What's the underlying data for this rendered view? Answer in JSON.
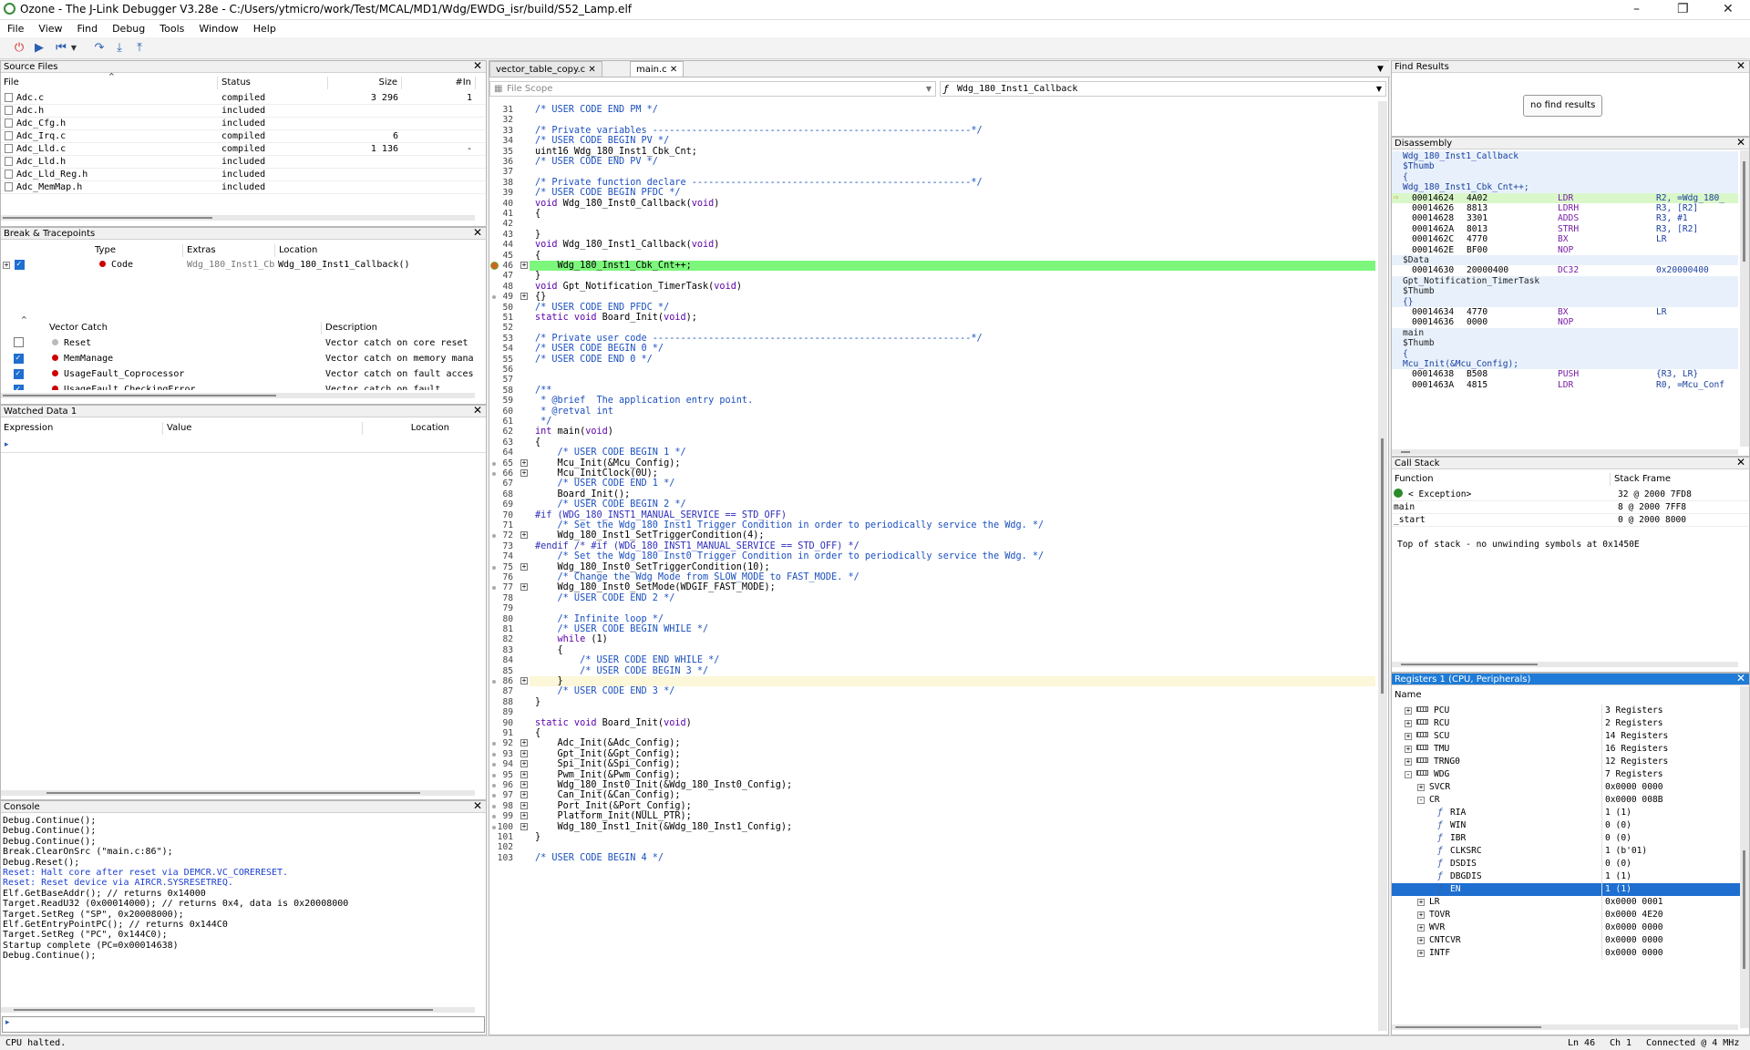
{
  "window": {
    "title": "Ozone - The J-Link Debugger V3.28e - C:/Users/ytmicro/work/Test/MCAL/MD1/Wdg/EWDG_isr/build/S52_Lamp.elf"
  },
  "menu": [
    "File",
    "View",
    "Find",
    "Debug",
    "Tools",
    "Window",
    "Help"
  ],
  "toolbar_icons": [
    "power-icon",
    "play-icon",
    "step-back-icon",
    "step-over-icon",
    "step-into-icon",
    "step-out-icon"
  ],
  "source_files": {
    "title": "Source Files",
    "columns": [
      "File",
      "Status",
      "Size",
      "#In"
    ],
    "rows": [
      {
        "file": "Adc.c",
        "status": "compiled",
        "size": "3 296",
        "in": "1"
      },
      {
        "file": "Adc.h",
        "status": "included",
        "size": "",
        "in": ""
      },
      {
        "file": "Adc_Cfg.h",
        "status": "included",
        "size": "",
        "in": ""
      },
      {
        "file": "Adc_Irq.c",
        "status": "compiled",
        "size": "6",
        "in": ""
      },
      {
        "file": "Adc_Lld.c",
        "status": "compiled",
        "size": "1 136",
        "in": "-"
      },
      {
        "file": "Adc_Lld.h",
        "status": "included",
        "size": "",
        "in": ""
      },
      {
        "file": "Adc_Lld_Reg.h",
        "status": "included",
        "size": "",
        "in": ""
      },
      {
        "file": "Adc_MemMap.h",
        "status": "included",
        "size": "",
        "in": ""
      }
    ]
  },
  "breakpoints": {
    "title": "Break & Tracepoints",
    "columns": [
      "Type",
      "Extras",
      "Location"
    ],
    "rows": [
      {
        "type": "Code",
        "extras": "Wdg_180_Inst1_Cb",
        "location": "Wdg_180_Inst1_Callback()"
      }
    ],
    "vector_catch_columns": [
      "Vector Catch",
      "Description"
    ],
    "vector_catch": [
      {
        "name": "Reset",
        "desc": "Vector catch on core reset",
        "checked": false
      },
      {
        "name": "MemManage",
        "desc": "Vector catch on memory mana",
        "checked": true
      },
      {
        "name": "UsageFault_Coprocessor",
        "desc": "Vector catch on fault acces",
        "checked": true
      },
      {
        "name": "UsageFault_CheckingError",
        "desc": "Vector catch on fault",
        "checked": true
      }
    ]
  },
  "watched": {
    "title": "Watched Data 1",
    "columns": [
      "Expression",
      "Value",
      "Location"
    ]
  },
  "console": {
    "title": "Console",
    "lines": [
      {
        "t": "Debug.Continue();",
        "c": "#000"
      },
      {
        "t": "Debug.Continue();",
        "c": "#000"
      },
      {
        "t": "Debug.Continue();",
        "c": "#000"
      },
      {
        "t": "Break.ClearOnSrc (\"main.c:86\");",
        "c": "#000"
      },
      {
        "t": "Debug.Reset();",
        "c": "#000"
      },
      {
        "t": "Reset: Halt core after reset via DEMCR.VC_CORERESET.",
        "c": "#1a3fd0"
      },
      {
        "t": "Reset: Reset device via AIRCR.SYSRESETREQ.",
        "c": "#1a3fd0"
      },
      {
        "t": "Elf.GetBaseAddr(); // returns 0x14000",
        "c": "#000"
      },
      {
        "t": "Target.ReadU32 (0x00014000); // returns 0x4, data is 0x20008000",
        "c": "#000"
      },
      {
        "t": "Target.SetReg (\"SP\", 0x20008000);",
        "c": "#000"
      },
      {
        "t": "Elf.GetEntryPointPC(); // returns 0x144C0",
        "c": "#000"
      },
      {
        "t": "Target.SetReg (\"PC\", 0x144C0);",
        "c": "#000"
      },
      {
        "t": "Startup complete (PC=0x00014638)",
        "c": "#000"
      },
      {
        "t": "Debug.Continue();",
        "c": "#000"
      }
    ]
  },
  "editor": {
    "tabs": [
      "vector_table_copy.c",
      "main.c"
    ],
    "scope": "File Scope",
    "function": "Wdg_180_Inst1_Callback"
  },
  "code": [
    {
      "n": "31",
      "s": "/* USER CODE END PM */",
      "k": "cm",
      "e": 0
    },
    {
      "n": "32",
      "s": "",
      "k": "",
      "e": 0
    },
    {
      "n": "33",
      "s": "/* Private variables ---------------------------------------------------------*/",
      "k": "cm",
      "e": 0
    },
    {
      "n": "34",
      "s": "/* USER CODE BEGIN PV */",
      "k": "cm",
      "e": 0
    },
    {
      "n": "35",
      "s": "uint16 Wdg_180_Inst1_Cbk_Cnt;",
      "k": "",
      "e": 0
    },
    {
      "n": "36",
      "s": "/* USER CODE END PV */",
      "k": "cm",
      "e": 0
    },
    {
      "n": "37",
      "s": "",
      "k": "",
      "e": 0
    },
    {
      "n": "38",
      "s": "/* Private function declare --------------------------------------------------*/",
      "k": "cm",
      "e": 0
    },
    {
      "n": "39",
      "s": "/* USER CODE BEGIN PFDC */",
      "k": "cm",
      "e": 0
    },
    {
      "n": "40",
      "s": "void Wdg_180_Inst0_Callback(void)",
      "k": "fn",
      "e": 0
    },
    {
      "n": "41",
      "s": "{",
      "k": "",
      "e": 0
    },
    {
      "n": "42",
      "s": "",
      "k": "",
      "e": 0
    },
    {
      "n": "43",
      "s": "}",
      "k": "",
      "e": 0
    },
    {
      "n": "44",
      "s": "void Wdg_180_Inst1_Callback(void)",
      "k": "fn",
      "e": 0
    },
    {
      "n": "45",
      "s": "{",
      "k": "",
      "e": 0
    },
    {
      "n": "46",
      "s": "    Wdg_180_Inst1_Cbk_Cnt++;",
      "k": "",
      "e": 1
    },
    {
      "n": "47",
      "s": "}",
      "k": "",
      "e": 0
    },
    {
      "n": "48",
      "s": "void Gpt_Notification_TimerTask(void)",
      "k": "fn",
      "e": 0
    },
    {
      "n": "49",
      "s": "{}",
      "k": "",
      "e": 1
    },
    {
      "n": "50",
      "s": "/* USER CODE END PFDC */",
      "k": "cm",
      "e": 0
    },
    {
      "n": "51",
      "s": "static void Board_Init(void);",
      "k": "fn2",
      "e": 0
    },
    {
      "n": "52",
      "s": "",
      "k": "",
      "e": 0
    },
    {
      "n": "53",
      "s": "/* Private user code ---------------------------------------------------------*/",
      "k": "cm",
      "e": 0
    },
    {
      "n": "54",
      "s": "/* USER CODE BEGIN 0 */",
      "k": "cm",
      "e": 0
    },
    {
      "n": "55",
      "s": "/* USER CODE END 0 */",
      "k": "cm",
      "e": 0
    },
    {
      "n": "56",
      "s": "",
      "k": "",
      "e": 0
    },
    {
      "n": "57",
      "s": "",
      "k": "",
      "e": 0
    },
    {
      "n": "58",
      "s": "/**",
      "k": "cm",
      "e": 0
    },
    {
      "n": "59",
      "s": " * @brief  The application entry point.",
      "k": "cm",
      "e": 0
    },
    {
      "n": "60",
      "s": " * @retval int",
      "k": "cm",
      "e": 0
    },
    {
      "n": "61",
      "s": " */",
      "k": "cm",
      "e": 0
    },
    {
      "n": "62",
      "s": "int main(void)",
      "k": "fn3",
      "e": 0
    },
    {
      "n": "63",
      "s": "{",
      "k": "",
      "e": 0
    },
    {
      "n": "64",
      "s": "    /* USER CODE BEGIN 1 */",
      "k": "cm",
      "e": 0
    },
    {
      "n": "65",
      "s": "    Mcu_Init(&Mcu_Config);",
      "k": "",
      "e": 1
    },
    {
      "n": "66",
      "s": "    Mcu_InitClock(0U);",
      "k": "",
      "e": 1
    },
    {
      "n": "67",
      "s": "    /* USER CODE END 1 */",
      "k": "cm",
      "e": 0
    },
    {
      "n": "68",
      "s": "    Board_Init();",
      "k": "",
      "e": 0
    },
    {
      "n": "69",
      "s": "    /* USER CODE BEGIN 2 */",
      "k": "cm",
      "e": 0
    },
    {
      "n": "70",
      "s": "#if (WDG_180_INST1_MANUAL_SERVICE == STD_OFF)",
      "k": "pp",
      "e": 0
    },
    {
      "n": "71",
      "s": "    /* Set the Wdg 180 Inst1 Trigger Condition in order to periodically service the Wdg. */",
      "k": "cm",
      "e": 0
    },
    {
      "n": "72",
      "s": "    Wdg_180_Inst1_SetTriggerCondition(4);",
      "k": "",
      "e": 1
    },
    {
      "n": "73",
      "s": "#endif /* #if (WDG_180_INST1_MANUAL_SERVICE == STD_OFF) */",
      "k": "pp",
      "e": 0
    },
    {
      "n": "74",
      "s": "    /* Set the Wdg 180 Inst0 Trigger Condition in order to periodically service the Wdg. */",
      "k": "cm",
      "e": 0
    },
    {
      "n": "75",
      "s": "    Wdg_180_Inst0_SetTriggerCondition(10);",
      "k": "",
      "e": 1
    },
    {
      "n": "76",
      "s": "    /* Change the Wdg Mode from SLOW_MODE to FAST_MODE. */",
      "k": "cm",
      "e": 0
    },
    {
      "n": "77",
      "s": "    Wdg_180_Inst0_SetMode(WDGIF_FAST_MODE);",
      "k": "",
      "e": 1
    },
    {
      "n": "78",
      "s": "    /* USER CODE END 2 */",
      "k": "cm",
      "e": 0
    },
    {
      "n": "79",
      "s": "",
      "k": "",
      "e": 0
    },
    {
      "n": "80",
      "s": "    /* Infinite loop */",
      "k": "cm",
      "e": 0
    },
    {
      "n": "81",
      "s": "    /* USER CODE BEGIN WHILE */",
      "k": "cm",
      "e": 0
    },
    {
      "n": "82",
      "s": "    while (1)",
      "k": "wh",
      "e": 0
    },
    {
      "n": "83",
      "s": "    {",
      "k": "",
      "e": 0
    },
    {
      "n": "84",
      "s": "        /* USER CODE END WHILE */",
      "k": "cm",
      "e": 0
    },
    {
      "n": "85",
      "s": "        /* USER CODE BEGIN 3 */",
      "k": "cm",
      "e": 0
    },
    {
      "n": "86",
      "s": "    }",
      "k": "",
      "e": 1
    },
    {
      "n": "87",
      "s": "    /* USER CODE END 3 */",
      "k": "cm",
      "e": 0
    },
    {
      "n": "88",
      "s": "}",
      "k": "",
      "e": 0
    },
    {
      "n": "89",
      "s": "",
      "k": "",
      "e": 0
    },
    {
      "n": "90",
      "s": "static void Board_Init(void)",
      "k": "fn2",
      "e": 0
    },
    {
      "n": "91",
      "s": "{",
      "k": "",
      "e": 0
    },
    {
      "n": "92",
      "s": "    Adc_Init(&Adc_Config);",
      "k": "",
      "e": 1
    },
    {
      "n": "93",
      "s": "    Gpt_Init(&Gpt_Config);",
      "k": "",
      "e": 1
    },
    {
      "n": "94",
      "s": "    Spi_Init(&Spi_Config);",
      "k": "",
      "e": 1
    },
    {
      "n": "95",
      "s": "    Pwm_Init(&Pwm_Config);",
      "k": "",
      "e": 1
    },
    {
      "n": "96",
      "s": "    Wdg_180_Inst0_Init(&Wdg_180_Inst0_Config);",
      "k": "",
      "e": 1
    },
    {
      "n": "97",
      "s": "    Can_Init(&Can_Config);",
      "k": "",
      "e": 1
    },
    {
      "n": "98",
      "s": "    Port_Init(&Port_Config);",
      "k": "",
      "e": 1
    },
    {
      "n": "99",
      "s": "    Platform_Init(NULL_PTR);",
      "k": "",
      "e": 1
    },
    {
      "n": "100",
      "s": "    Wdg_180_Inst1_Init(&Wdg_180_Inst1_Config);",
      "k": "",
      "e": 1
    },
    {
      "n": "101",
      "s": "}",
      "k": "",
      "e": 0
    },
    {
      "n": "102",
      "s": "",
      "k": "",
      "e": 0
    },
    {
      "n": "103",
      "s": "/* USER CODE BEGIN 4 */",
      "k": "cm",
      "e": 0
    }
  ],
  "current_line": "46",
  "highlight_line": "86",
  "find_results": {
    "title": "Find Results",
    "button": "no find results"
  },
  "disassembly": {
    "title": "Disassembly",
    "rows": [
      {
        "type": "label",
        "text": "Wdg_180_Inst1_Callback"
      },
      {
        "type": "label",
        "text": "$Thumb"
      },
      {
        "type": "label",
        "text": "{"
      },
      {
        "type": "label",
        "text": "Wdg_180_Inst1_Cbk_Cnt++;"
      },
      {
        "type": "ins",
        "addr": "00014624",
        "op": "4A02",
        "mn": "LDR",
        "args": "R2, =Wdg_180_",
        "cur": true
      },
      {
        "type": "ins",
        "addr": "00014626",
        "op": "8813",
        "mn": "LDRH",
        "args": "R3, [R2]"
      },
      {
        "type": "ins",
        "addr": "00014628",
        "op": "3301",
        "mn": "ADDS",
        "args": "R3, #1"
      },
      {
        "type": "ins",
        "addr": "0001462A",
        "op": "8013",
        "mn": "STRH",
        "args": "R3, [R2]"
      },
      {
        "type": "ins",
        "addr": "0001462C",
        "op": "4770",
        "mn": "BX",
        "args": "LR"
      },
      {
        "type": "ins",
        "addr": "0001462E",
        "op": "BF00",
        "mn": "NOP",
        "args": ""
      },
      {
        "type": "label2",
        "text": "$Data"
      },
      {
        "type": "ins",
        "addr": "00014630",
        "op": "20000400",
        "mn": "DC32",
        "args": "0x20000400"
      },
      {
        "type": "label2",
        "text": "Gpt_Notification_TimerTask"
      },
      {
        "type": "label2",
        "text": "$Thumb"
      },
      {
        "type": "label",
        "text": "{}"
      },
      {
        "type": "ins",
        "addr": "00014634",
        "op": "4770",
        "mn": "BX",
        "args": "LR"
      },
      {
        "type": "ins",
        "addr": "00014636",
        "op": "0000",
        "mn": "NOP",
        "args": ""
      },
      {
        "type": "label2",
        "text": "main"
      },
      {
        "type": "label2",
        "text": "$Thumb"
      },
      {
        "type": "label",
        "text": "{"
      },
      {
        "type": "label",
        "text": "Mcu_Init(&Mcu_Config);"
      },
      {
        "type": "ins",
        "addr": "00014638",
        "op": "B508",
        "mn": "PUSH",
        "args": "{R3, LR}"
      },
      {
        "type": "ins",
        "addr": "0001463A",
        "op": "4815",
        "mn": "LDR",
        "args": "R0, =Mcu_Conf"
      }
    ]
  },
  "call_stack": {
    "title": "Call Stack",
    "columns": [
      "Function",
      "Stack Frame"
    ],
    "rows": [
      {
        "fn": "< Exception>",
        "frame": "32 @ 2000 7FD8"
      },
      {
        "fn": "main",
        "frame": "8 @ 2000 7FF8"
      },
      {
        "fn": "_start",
        "frame": "0 @ 2000 8000"
      }
    ],
    "note": "Top of stack - no unwinding symbols at 0x1450E"
  },
  "registers": {
    "title": "Registers 1 (CPU, Peripherals)",
    "column": "Name",
    "rows": [
      {
        "lvl": 1,
        "tog": "+",
        "ico": "reg",
        "name": "PCU",
        "val": "3 Registers"
      },
      {
        "lvl": 1,
        "tog": "+",
        "ico": "reg",
        "name": "RCU",
        "val": "2 Registers"
      },
      {
        "lvl": 1,
        "tog": "+",
        "ico": "reg",
        "name": "SCU",
        "val": "14 Registers"
      },
      {
        "lvl": 1,
        "tog": "+",
        "ico": "reg",
        "name": "TMU",
        "val": "16 Registers"
      },
      {
        "lvl": 1,
        "tog": "+",
        "ico": "reg",
        "name": "TRNG0",
        "val": "12 Registers"
      },
      {
        "lvl": 1,
        "tog": "-",
        "ico": "reg",
        "name": "WDG",
        "val": "7 Registers"
      },
      {
        "lvl": 2,
        "tog": "+",
        "ico": "",
        "name": "SVCR",
        "val": "0x0000 0000"
      },
      {
        "lvl": 2,
        "tog": "-",
        "ico": "",
        "name": "CR",
        "val": "0x0000 008B"
      },
      {
        "lvl": 3,
        "tog": "",
        "ico": "bit",
        "name": "RIA",
        "val": "1 (1)"
      },
      {
        "lvl": 3,
        "tog": "",
        "ico": "bit",
        "name": "WIN",
        "val": "0 (0)"
      },
      {
        "lvl": 3,
        "tog": "",
        "ico": "bit",
        "name": "IBR",
        "val": "0 (0)"
      },
      {
        "lvl": 3,
        "tog": "",
        "ico": "bit",
        "name": "CLKSRC",
        "val": "1 (b'01)"
      },
      {
        "lvl": 3,
        "tog": "",
        "ico": "bit",
        "name": "DSDIS",
        "val": "0 (0)"
      },
      {
        "lvl": 3,
        "tog": "",
        "ico": "bit",
        "name": "DBGDIS",
        "val": "1 (1)"
      },
      {
        "lvl": 3,
        "tog": "",
        "ico": "bit",
        "name": "EN",
        "val": "1 (1)",
        "sel": true
      },
      {
        "lvl": 2,
        "tog": "+",
        "ico": "",
        "name": "LR",
        "val": "0x0000 0001"
      },
      {
        "lvl": 2,
        "tog": "+",
        "ico": "",
        "name": "TOVR",
        "val": "0x0000 4E20"
      },
      {
        "lvl": 2,
        "tog": "+",
        "ico": "",
        "name": "WVR",
        "val": "0x0000 0000"
      },
      {
        "lvl": 2,
        "tog": "+",
        "ico": "",
        "name": "CNTCVR",
        "val": "0x0000 0000"
      },
      {
        "lvl": 2,
        "tog": "+",
        "ico": "",
        "name": "INTF",
        "val": "0x0000 0000"
      }
    ]
  },
  "status": {
    "left": "CPU halted.",
    "line": "Ln 46",
    "col": "Ch 1",
    "conn": "Connected @ 4 MHz"
  }
}
